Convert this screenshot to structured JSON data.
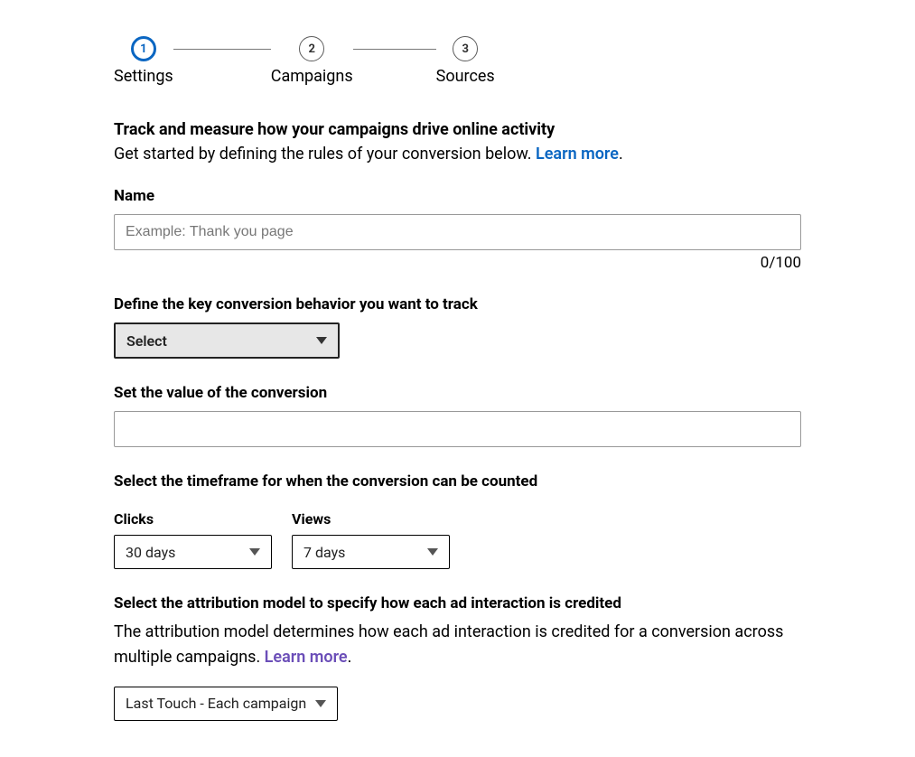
{
  "stepper": {
    "steps": [
      {
        "num": "1",
        "label": "Settings"
      },
      {
        "num": "2",
        "label": "Campaigns"
      },
      {
        "num": "3",
        "label": "Sources"
      }
    ]
  },
  "intro": {
    "title": "Track and measure how your campaigns drive online activity",
    "subtitle_prefix": "Get started by defining the rules of your conversion below. ",
    "learn_more": "Learn more",
    "subtitle_suffix": "."
  },
  "name_field": {
    "label": "Name",
    "placeholder": "Example: Thank you page",
    "counter": "0/100"
  },
  "behavior": {
    "label": "Define the key conversion behavior you want to track",
    "select_value": "Select"
  },
  "value_field": {
    "label": "Set the value of the conversion"
  },
  "timeframe": {
    "label": "Select the timeframe for when the conversion can be counted",
    "clicks_label": "Clicks",
    "clicks_value": "30 days",
    "views_label": "Views",
    "views_value": "7 days"
  },
  "attribution": {
    "label": "Select the attribution model to specify how each ad interaction is credited",
    "body_prefix": "The attribution model determines how each ad interaction is credited for a conversion across multiple campaigns. ",
    "learn_more": "Learn more",
    "body_suffix": ".",
    "select_value": "Last Touch - Each campaign"
  }
}
